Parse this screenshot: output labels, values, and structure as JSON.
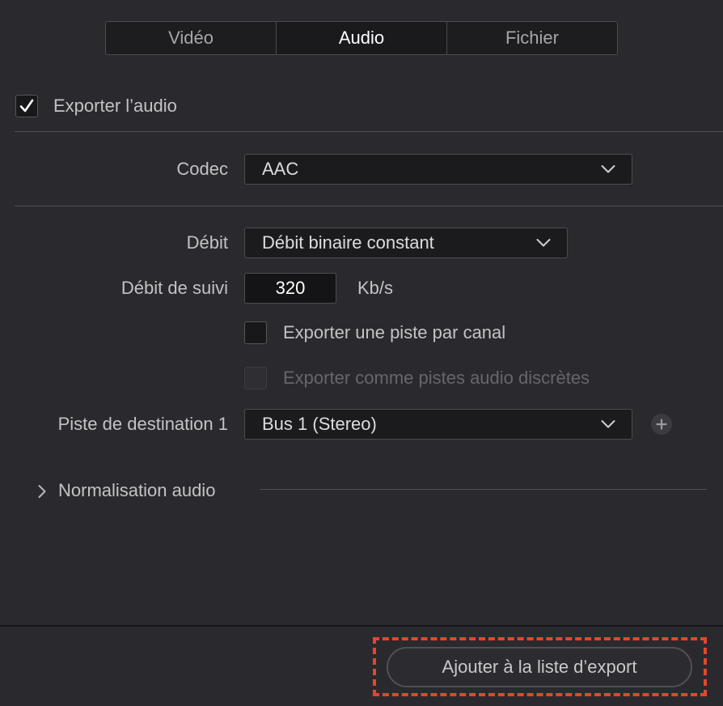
{
  "tabs": [
    {
      "label": "Vidéo",
      "active": false
    },
    {
      "label": "Audio",
      "active": true
    },
    {
      "label": "Fichier",
      "active": false
    }
  ],
  "export_audio": {
    "label": "Exporter l’audio",
    "checked": true
  },
  "codec": {
    "label": "Codec",
    "value": "AAC"
  },
  "debit": {
    "label": "Débit",
    "value": "Débit binaire constant"
  },
  "debit_suivi": {
    "label": "Débit de suivi",
    "value": "320",
    "unit": "Kb/s"
  },
  "export_track_per_channel": {
    "label": "Exporter une piste par canal",
    "checked": false
  },
  "export_discrete": {
    "label": "Exporter comme pistes audio discrètes",
    "checked": false,
    "disabled": true
  },
  "destination": {
    "label": "Piste de destination 1",
    "value": "Bus 1 (Stereo)"
  },
  "normalisation": {
    "label": "Normalisation audio",
    "expanded": false
  },
  "footer": {
    "export_button_label": "Ajouter à la liste d’export"
  },
  "colors": {
    "background": "#2a2a2e",
    "highlight": "#e5452d"
  },
  "icons": {
    "check": "checkmark-icon",
    "chevron": "chevron-down-icon",
    "expand": "chevron-right-icon",
    "add": "plus-icon"
  }
}
